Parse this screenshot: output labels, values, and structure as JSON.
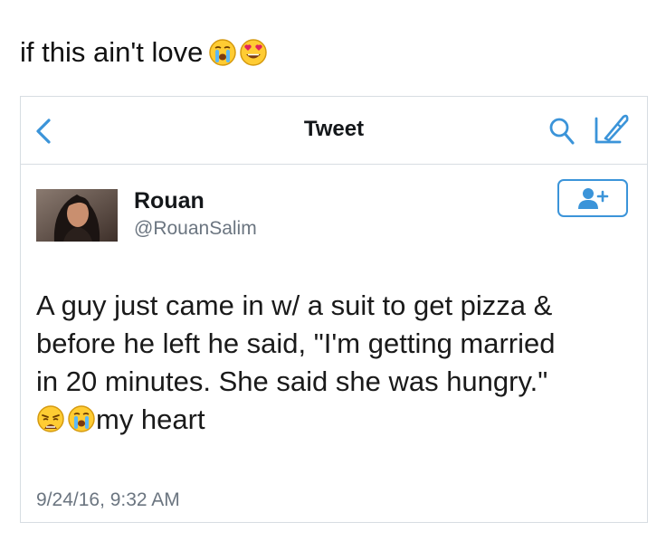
{
  "caption": {
    "text": "if this ain't love",
    "emojis": [
      "loudly-crying-face",
      "heart-eyes-face"
    ]
  },
  "navbar": {
    "back_icon": "chevron-left-icon",
    "title": "Tweet",
    "search_icon": "search-icon",
    "compose_icon": "compose-icon",
    "accent": "#3b94d9"
  },
  "tweet": {
    "author_name": "Rouan",
    "author_handle": "@RouanSalim",
    "follow_icon": "follow-user-icon",
    "lines": [
      "A guy just came in w/ a suit to get pizza &",
      "before he left he said, \"I'm getting married",
      "in 20 minutes. She said she was hungry.\""
    ],
    "last_line_emojis": [
      "weary-face",
      "loudly-crying-face"
    ],
    "last_line_text": "my heart",
    "timestamp": "9/24/16, 9:32 AM"
  }
}
